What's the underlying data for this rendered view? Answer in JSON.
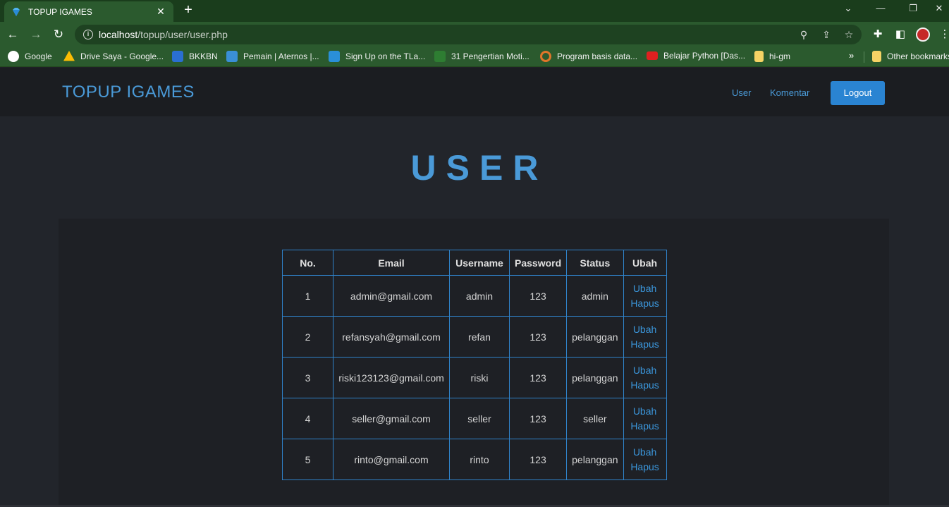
{
  "browser": {
    "tab_title": "TOPUP IGAMES",
    "url_host": "localhost",
    "url_path": "/topup/user/user.php",
    "bookmarks": [
      {
        "label": "Google",
        "color": "#ffffff"
      },
      {
        "label": "Drive Saya - Google...",
        "color": "#fbbc04"
      },
      {
        "label": "BKKBN",
        "color": "#2a6fd1"
      },
      {
        "label": "Pemain | Aternos |...",
        "color": "#3a8fd6"
      },
      {
        "label": "Sign Up on the TLa...",
        "color": "#2a8fd8"
      },
      {
        "label": "31 Pengertian Moti...",
        "color": "#2e7d32"
      },
      {
        "label": "Program basis data...",
        "color": "#e0762a"
      },
      {
        "label": "Belajar Python [Das...",
        "color": "#e02020"
      },
      {
        "label": "hi-gm",
        "color": "#f6d365"
      }
    ],
    "other_bookmarks": "Other bookmarks"
  },
  "nav": {
    "brand": "TOPUP IGAMES",
    "links": [
      "User",
      "Komentar"
    ],
    "logout": "Logout"
  },
  "page_title": "USER",
  "table": {
    "headers": [
      "No.",
      "Email",
      "Username",
      "Password",
      "Status",
      "Ubah"
    ],
    "rows": [
      {
        "no": "1",
        "email": "admin@gmail.com",
        "username": "admin",
        "password": "123",
        "status": "admin"
      },
      {
        "no": "2",
        "email": "refansyah@gmail.com",
        "username": "refan",
        "password": "123",
        "status": "pelanggan"
      },
      {
        "no": "3",
        "email": "riski123123@gmail.com",
        "username": "riski",
        "password": "123",
        "status": "pelanggan"
      },
      {
        "no": "4",
        "email": "seller@gmail.com",
        "username": "seller",
        "password": "123",
        "status": "seller"
      },
      {
        "no": "5",
        "email": "rinto@gmail.com",
        "username": "rinto",
        "password": "123",
        "status": "pelanggan"
      }
    ],
    "action_edit": "Ubah",
    "action_delete": "Hapus"
  },
  "colors": {
    "accent": "#4a9ad8",
    "chrome": "#2b5a2e",
    "button": "#2a84d2"
  }
}
